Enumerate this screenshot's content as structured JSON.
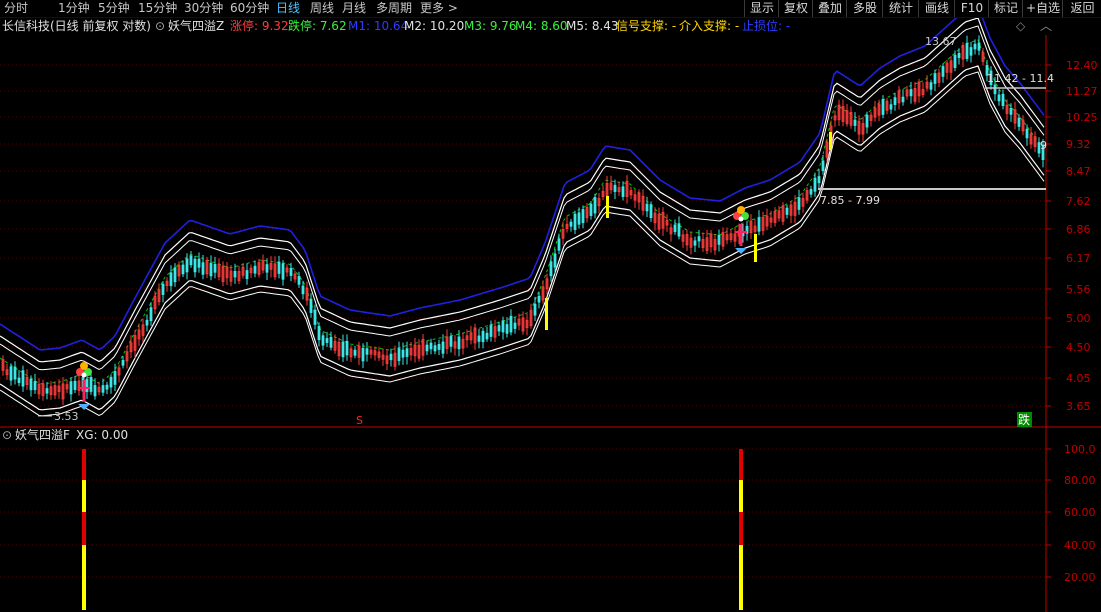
{
  "toolbar": {
    "left": [
      {
        "label": "分时",
        "active": false
      },
      {
        "label": "1分钟",
        "active": false
      },
      {
        "label": "5分钟",
        "active": false
      },
      {
        "label": "15分钟",
        "active": false
      },
      {
        "label": "30分钟",
        "active": false
      },
      {
        "label": "60分钟",
        "active": false
      },
      {
        "label": "日线",
        "active": true
      },
      {
        "label": "周线",
        "active": false
      },
      {
        "label": "月线",
        "active": false
      },
      {
        "label": "多周期",
        "active": false
      },
      {
        "label": "更多 >",
        "active": false
      }
    ],
    "right": [
      "显示",
      "复权",
      "叠加",
      "多股",
      "统计",
      "画线",
      "F10",
      "标记",
      "+自选",
      "返回"
    ]
  },
  "info": {
    "title": "长信科技(日线 前复权 对数)",
    "indicator_name": "妖气四溢Z",
    "zhangting": "涨停: 9.32",
    "dieting": "跌停: 7.62",
    "m1": "M1: 10.64",
    "m2": "M2: 10.20",
    "m3": "M3: 9.76",
    "m4": "M4: 8.60",
    "m5": "M5: 8.43",
    "signal": "信号支撑: -",
    "entry": "介入支撑: -",
    "stop": "止损位: -"
  },
  "colors": {
    "up": "#ff3c3c",
    "down": "#3ce6e6",
    "upper_band": "#2020e0",
    "channel": "#ffffff",
    "mid": "#00c800",
    "grid": "#5a0000",
    "axis": "#c00000",
    "ind_red": "#e00000",
    "ind_yellow": "#ffff00"
  },
  "price_axis": [
    "12.40",
    "11.27",
    "10.25",
    "9.32",
    "8.47",
    "7.62",
    "6.86",
    "6.17",
    "5.56",
    "5.00",
    "4.50",
    "4.05",
    "3.65"
  ],
  "annotations": {
    "low": "3.53",
    "high": "13.67",
    "range1": "11.42 - 11.4",
    "range2": "7.85 - 7.99",
    "edge_mark": "9",
    "s_mark": "S",
    "die_tag": "跌"
  },
  "indicator": {
    "name": "妖气四溢F",
    "xg": "XG: 0.00",
    "axis": [
      "100.0",
      "80.00",
      "60.00",
      "40.00",
      "20.00"
    ]
  }
}
